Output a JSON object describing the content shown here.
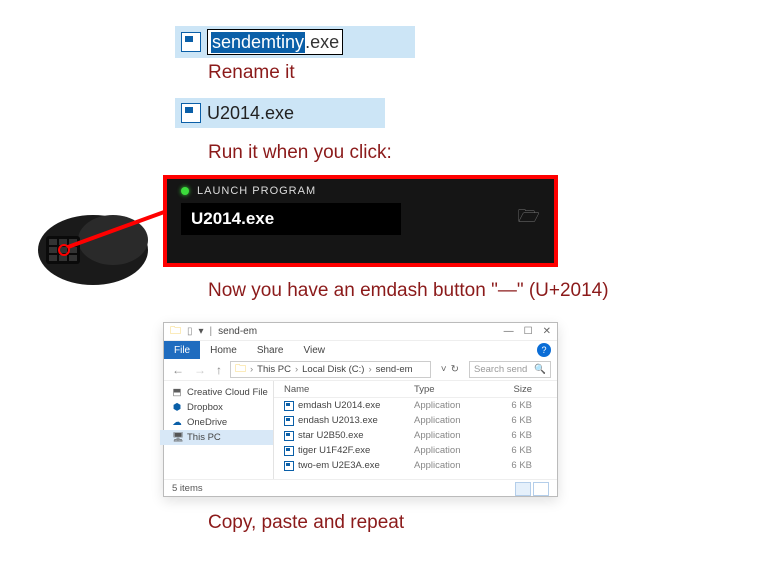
{
  "step1": {
    "selected_text": "sendemtiny",
    "rest_text": ".exe",
    "instruction": "Rename it"
  },
  "step2": {
    "filename": "U2014.exe",
    "instruction": "Run it when you click:"
  },
  "launch": {
    "title": "LAUNCH PROGRAM",
    "filename": "U2014.exe"
  },
  "step3_instruction": "Now you have an emdash button \"—\" (U+2014)",
  "explorer": {
    "window_title": "send-em",
    "ribbon": {
      "file": "File",
      "home": "Home",
      "share": "Share",
      "view": "View"
    },
    "breadcrumbs": [
      "This PC",
      "Local Disk (C:)",
      "send-em"
    ],
    "search_placeholder": "Search send",
    "tree": [
      {
        "icon": "⬒",
        "label": "Creative Cloud File",
        "color": "#5e5e5e"
      },
      {
        "icon": "⬢",
        "label": "Dropbox",
        "color": "#0a5fa8"
      },
      {
        "icon": "☁",
        "label": "OneDrive",
        "color": "#0a5fa8"
      },
      {
        "icon": "🖥",
        "label": "This PC",
        "color": "#555",
        "selected": true
      }
    ],
    "columns": {
      "name": "Name",
      "type": "Type",
      "size": "Size"
    },
    "rows": [
      {
        "name": "emdash U2014.exe",
        "type": "Application",
        "size": "6 KB"
      },
      {
        "name": "endash U2013.exe",
        "type": "Application",
        "size": "6 KB"
      },
      {
        "name": "star U2B50.exe",
        "type": "Application",
        "size": "6 KB"
      },
      {
        "name": "tiger U1F42F.exe",
        "type": "Application",
        "size": "6 KB"
      },
      {
        "name": "two-em U2E3A.exe",
        "type": "Application",
        "size": "6 KB"
      }
    ],
    "status": "5 items"
  },
  "step4_instruction": "Copy, paste and repeat"
}
